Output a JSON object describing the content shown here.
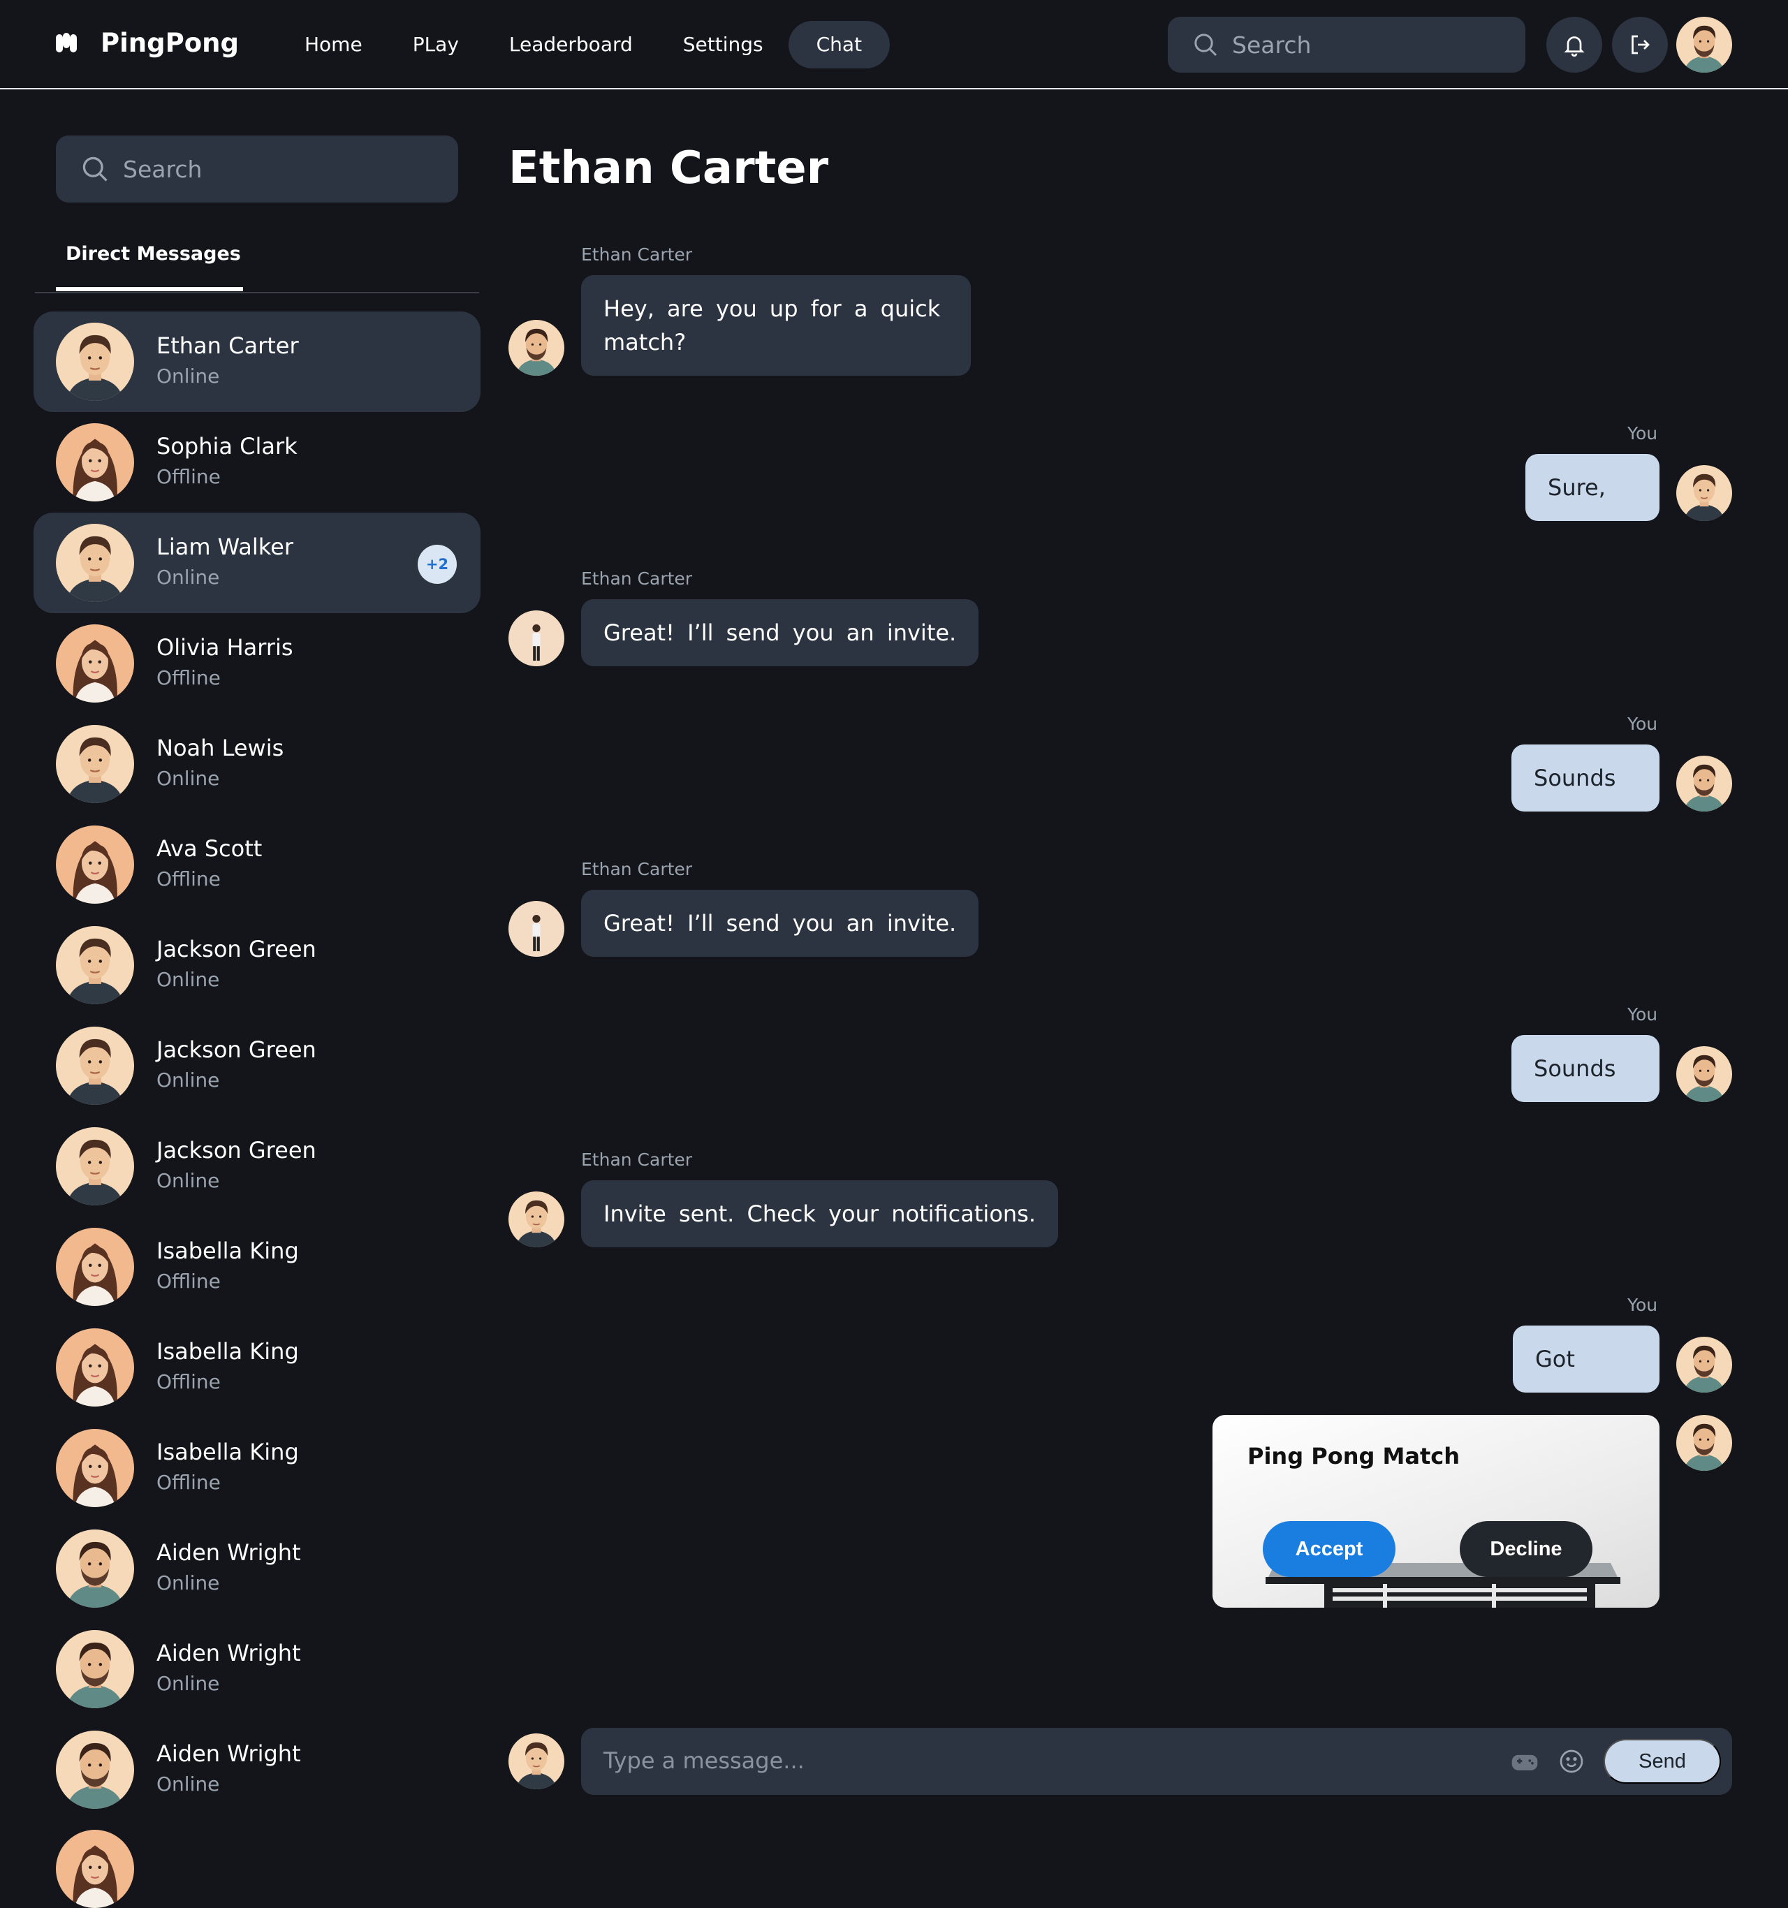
{
  "app": {
    "name": "PingPong"
  },
  "nav": {
    "links": [
      "Home",
      "PLay",
      "Leaderboard",
      "Settings",
      "Chat"
    ],
    "active": "Chat",
    "search_placeholder": "Search"
  },
  "sidebar": {
    "search_placeholder": "Search",
    "tab_label": "Direct Messages",
    "contacts": [
      {
        "name": "Ethan Carter",
        "status": "Online",
        "highlighted": true
      },
      {
        "name": "Sophia Clark",
        "status": "Offline"
      },
      {
        "name": "Liam Walker",
        "status": "Online",
        "highlighted": true,
        "badge": "+2"
      },
      {
        "name": "Olivia Harris",
        "status": "Offline"
      },
      {
        "name": "Noah Lewis",
        "status": "Online"
      },
      {
        "name": "Ava Scott",
        "status": "Offline"
      },
      {
        "name": "Jackson Green",
        "status": "Online"
      },
      {
        "name": "Jackson Green",
        "status": "Online"
      },
      {
        "name": "Jackson Green",
        "status": "Online"
      },
      {
        "name": "Isabella King",
        "status": "Offline"
      },
      {
        "name": "Isabella King",
        "status": "Offline"
      },
      {
        "name": "Isabella King",
        "status": "Offline"
      },
      {
        "name": "Aiden Wright",
        "status": "Online"
      },
      {
        "name": "Aiden Wright",
        "status": "Online"
      },
      {
        "name": "Aiden Wright",
        "status": "Online"
      }
    ]
  },
  "chat": {
    "title": "Ethan Carter",
    "messages": [
      {
        "from": "Ethan Carter",
        "text_line1": "Hey, are you up for a quick",
        "text_line2": "match?"
      },
      {
        "from": "You",
        "text": "Sure,"
      },
      {
        "from": "Ethan Carter",
        "text": "Great! I’ll send you an invite."
      },
      {
        "from": "You",
        "text": "Sounds"
      },
      {
        "from": "Ethan Carter",
        "text": "Great! I’ll send you an invite."
      },
      {
        "from": "You",
        "text": "Sounds"
      },
      {
        "from": "Ethan Carter",
        "text": "Invite sent. Check your notifications."
      },
      {
        "from": "You",
        "text": "Got"
      }
    ],
    "invite": {
      "title": "Ping Pong Match",
      "accept_label": "Accept",
      "decline_label": "Decline"
    },
    "composer": {
      "placeholder": "Type a message...",
      "send_label": "Send"
    }
  },
  "colors": {
    "background": "#13151a",
    "surface": "#2b3440",
    "outgoing_bubble": "#c9d8ea",
    "accept": "#1a7ee0",
    "badge_text": "#1f6fd1"
  },
  "icons": [
    "logo-icon",
    "search-icon",
    "bell-icon",
    "logout-icon",
    "gamepad-icon",
    "emoji-icon"
  ]
}
